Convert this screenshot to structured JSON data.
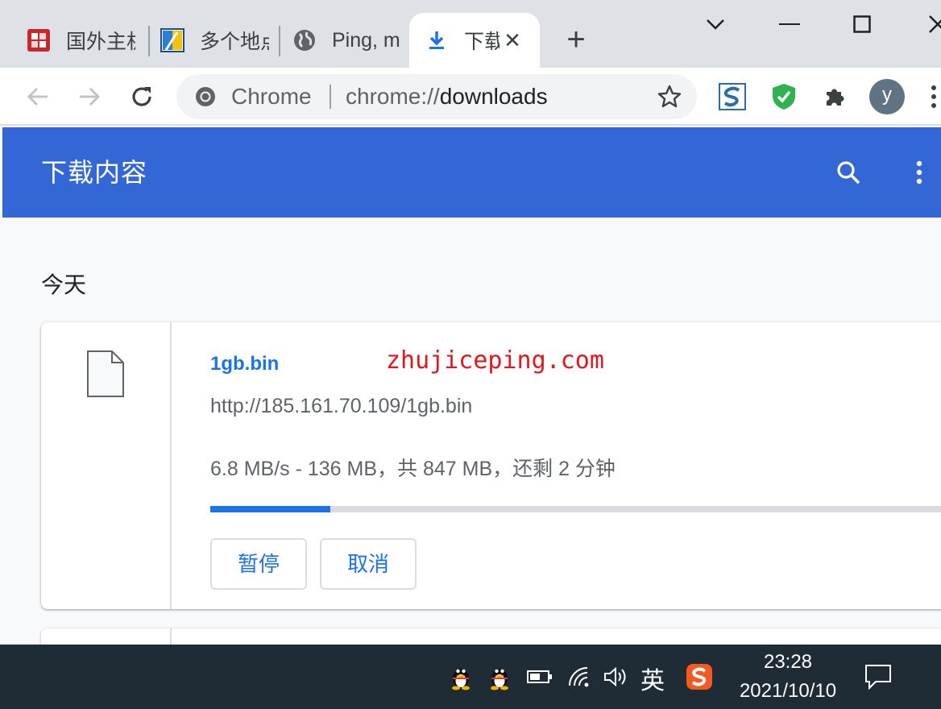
{
  "tabs": [
    {
      "title": "国外主机",
      "icon": "red-seal-icon"
    },
    {
      "title": "多个地点",
      "icon": "map-tiles-icon"
    },
    {
      "title": "Ping, m",
      "icon": "globe-icon"
    },
    {
      "title": "下载",
      "icon": "download-arrow-icon",
      "active": true
    }
  ],
  "omnibox": {
    "chip": "Chrome",
    "url_scheme": "chrome://",
    "url_path": "downloads"
  },
  "profile": {
    "initial": "y"
  },
  "downloads": {
    "title": "下载内容",
    "date_label": "今天",
    "item": {
      "file_name": "1gb.bin",
      "watermark": "zhujiceping.com",
      "url": "http://185.161.70.109/1gb.bin",
      "status": "6.8 MB/s - 136 MB，共 847 MB，还剩 2 分钟",
      "progress_fraction": 0.16,
      "pause_label": "暂停",
      "cancel_label": "取消"
    }
  },
  "taskbar": {
    "ime_label": "英",
    "time": "23:28",
    "date": "2021/10/10"
  },
  "colors": {
    "header_blue": "#3367d6",
    "link_blue": "#1a73e8",
    "watermark_red": "#e5151b",
    "taskbar": "#1f2b35"
  }
}
